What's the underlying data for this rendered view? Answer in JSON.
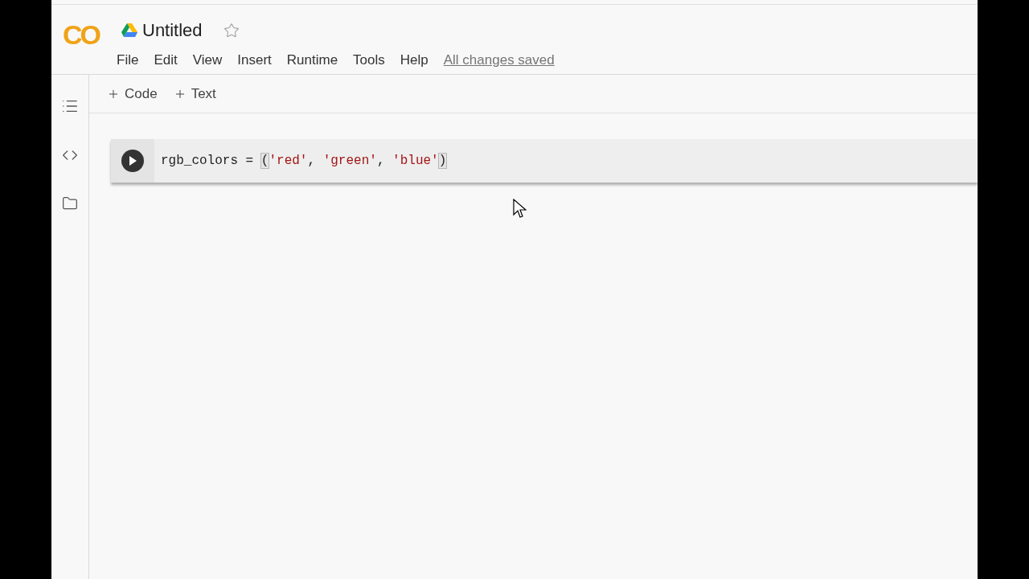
{
  "header": {
    "logo": "CO",
    "title": "Untitled",
    "starred": false,
    "menu": [
      "File",
      "Edit",
      "View",
      "Insert",
      "Runtime",
      "Tools",
      "Help"
    ],
    "save_status": "All changes saved"
  },
  "toolbar": [
    "Code",
    "Text"
  ],
  "cell": {
    "tokens": [
      {
        "kind": "name",
        "text": "rgb_colors"
      },
      {
        "kind": "op",
        "text": " = "
      },
      {
        "kind": "bracket",
        "text": "("
      },
      {
        "kind": "string",
        "text": "'red'"
      },
      {
        "kind": "op",
        "text": ", "
      },
      {
        "kind": "string",
        "text": "'green'"
      },
      {
        "kind": "op",
        "text": ", "
      },
      {
        "kind": "string",
        "text": "'blue'"
      },
      {
        "kind": "bracket",
        "text": ")"
      }
    ]
  }
}
